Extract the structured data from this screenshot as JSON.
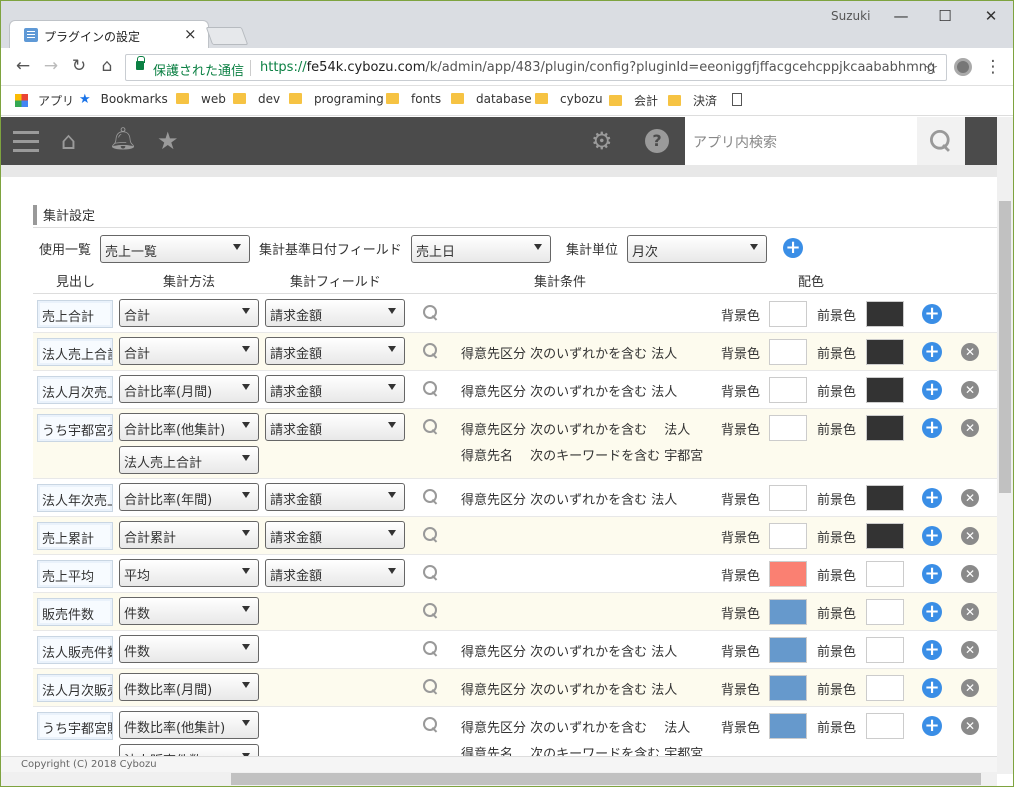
{
  "browser": {
    "tab_title": "プラグインの設定",
    "tab_close": "×",
    "user": "Suzuki",
    "minimize": "—",
    "maximize": "☐",
    "close": "✕",
    "back": "←",
    "forward": "→",
    "reload": "↻",
    "home": "⌂",
    "secure_text": "保護された通信",
    "url_scheme": "https://",
    "url_host": "fe54k.cybozu.com",
    "url_path": "/k/admin/app/483/plugin/config?pluginId=eeoniggfjffacgcehcppjkcaababhmng",
    "star": "☆",
    "menu": "⋮"
  },
  "bookmarks": {
    "apps": "アプリ",
    "items": [
      "Bookmarks",
      "web",
      "dev",
      "programing",
      "fonts",
      "database",
      "cybozu",
      "会計",
      "決済"
    ]
  },
  "header": {
    "search_placeholder": "アプリ内検索"
  },
  "section": {
    "title": "集計設定"
  },
  "settings": {
    "list_label": "使用一覧",
    "list_value": "売上一覧",
    "date_field_label": "集計基準日付フィールド",
    "date_field_value": "売上日",
    "unit_label": "集計単位",
    "unit_value": "月次"
  },
  "columns": {
    "heading": "見出し",
    "method": "集計方法",
    "field": "集計フィールド",
    "condition": "集計条件",
    "color": "配色"
  },
  "color_labels": {
    "bg": "背景色",
    "fg": "前景色"
  },
  "rows": [
    {
      "heading": "売上合計",
      "method": "合計",
      "field": "請求金額",
      "cond1": "",
      "cond2": "",
      "bg": "#ffffff",
      "fg": "#333333",
      "remove": false
    },
    {
      "heading": "法人売上合計",
      "method": "合計",
      "field": "請求金額",
      "cond1": "得意先区分 次のいずれかを含む 法人",
      "cond2": "",
      "bg": "#ffffff",
      "fg": "#333333",
      "remove": true
    },
    {
      "heading": "法人月次売上",
      "method": "合計比率(月間)",
      "field": "請求金額",
      "cond1": "得意先区分 次のいずれかを含む 法人",
      "cond2": "",
      "bg": "#ffffff",
      "fg": "#333333",
      "remove": true
    },
    {
      "heading": "うち宇都宮売上",
      "method": "合計比率(他集計)",
      "method2": "法人売上合計",
      "field": "請求金額",
      "cond1": "得意先区分 次のいずれかを含む　 法人",
      "cond2": "得意先名　 次のキーワードを含む 宇都宮",
      "bg": "#ffffff",
      "fg": "#333333",
      "remove": true
    },
    {
      "heading": "法人年次売上",
      "method": "合計比率(年間)",
      "field": "請求金額",
      "cond1": "得意先区分 次のいずれかを含む 法人",
      "cond2": "",
      "bg": "#ffffff",
      "fg": "#333333",
      "remove": true
    },
    {
      "heading": "売上累計",
      "method": "合計累計",
      "field": "請求金額",
      "cond1": "",
      "cond2": "",
      "bg": "#ffffff",
      "fg": "#333333",
      "remove": true
    },
    {
      "heading": "売上平均",
      "method": "平均",
      "field": "請求金額",
      "cond1": "",
      "cond2": "",
      "bg": "#fa8072",
      "fg": "#ffffff",
      "remove": true
    },
    {
      "heading": "販売件数",
      "method": "件数",
      "field": "",
      "cond1": "",
      "cond2": "",
      "bg": "#6699cc",
      "fg": "#ffffff",
      "remove": true
    },
    {
      "heading": "法人販売件数",
      "method": "件数",
      "field": "",
      "cond1": "得意先区分 次のいずれかを含む 法人",
      "cond2": "",
      "bg": "#6699cc",
      "fg": "#ffffff",
      "remove": true
    },
    {
      "heading": "法人月次販売",
      "method": "件数比率(月間)",
      "field": "",
      "cond1": "得意先区分 次のいずれかを含む 法人",
      "cond2": "",
      "bg": "#6699cc",
      "fg": "#ffffff",
      "remove": true
    },
    {
      "heading": "うち宇都宮販売",
      "method": "件数比率(他集計)",
      "method2": "法人販売件数",
      "field": "",
      "cond1": "得意先区分 次のいずれかを含む　 法人",
      "cond2": "得意先名　 次のキーワードを含む 宇都宮",
      "bg": "#6699cc",
      "fg": "#ffffff",
      "remove": true
    }
  ],
  "footer": {
    "copyright": "Copyright (C) 2018 Cybozu"
  }
}
